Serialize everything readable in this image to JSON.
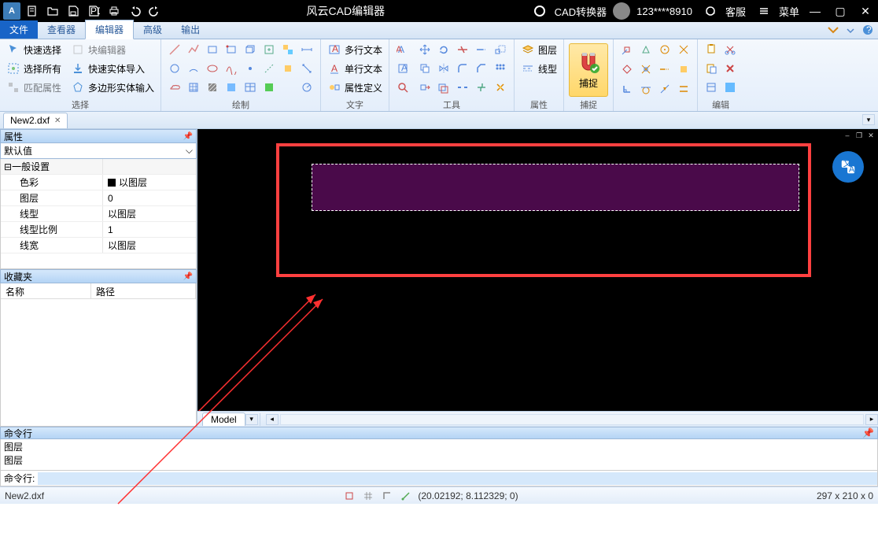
{
  "titlebar": {
    "title": "风云CAD编辑器",
    "converter": "CAD转换器",
    "user": "123****8910",
    "support": "客服",
    "menu": "菜单"
  },
  "menutabs": {
    "file": "文件",
    "viewer": "查看器",
    "editor": "编辑器",
    "advanced": "高级",
    "output": "输出"
  },
  "ribbon": {
    "select": {
      "quick": "快速选择",
      "all": "选择所有",
      "match": "匹配属性",
      "blockedit": "块编辑器",
      "solidimport": "快速实体导入",
      "polyimport": "多边形实体输入",
      "label": "选择"
    },
    "draw": {
      "label": "绘制"
    },
    "text": {
      "multiline": "多行文本",
      "singleline": "单行文本",
      "attrdef": "属性定义",
      "label": "文字"
    },
    "tools": {
      "label": "工具"
    },
    "props": {
      "layer": "图层",
      "linetype": "线型",
      "label": "属性"
    },
    "snap": {
      "btn": "捕捉",
      "label": "捕捉"
    },
    "edit": {
      "label": "编辑"
    }
  },
  "filetab": {
    "name": "New2.dxf"
  },
  "panels": {
    "properties": {
      "title": "属性",
      "default": "默认值",
      "general": "一般设置",
      "rows": [
        {
          "k": "色彩",
          "v": "以图层",
          "swatch": true
        },
        {
          "k": "图层",
          "v": "0"
        },
        {
          "k": "线型",
          "v": "以图层"
        },
        {
          "k": "线型比例",
          "v": "1"
        },
        {
          "k": "线宽",
          "v": "以图层"
        }
      ]
    },
    "favorites": {
      "title": "收藏夹",
      "col1": "名称",
      "col2": "路径"
    },
    "command": {
      "title": "命令行",
      "log": [
        "图层",
        "图层"
      ],
      "prompt": "命令行:"
    }
  },
  "model": {
    "tab": "Model"
  },
  "status": {
    "file": "New2.dxf",
    "coords": "(20.02192; 8.112329; 0)",
    "dims": "297 x 210 x 0"
  }
}
